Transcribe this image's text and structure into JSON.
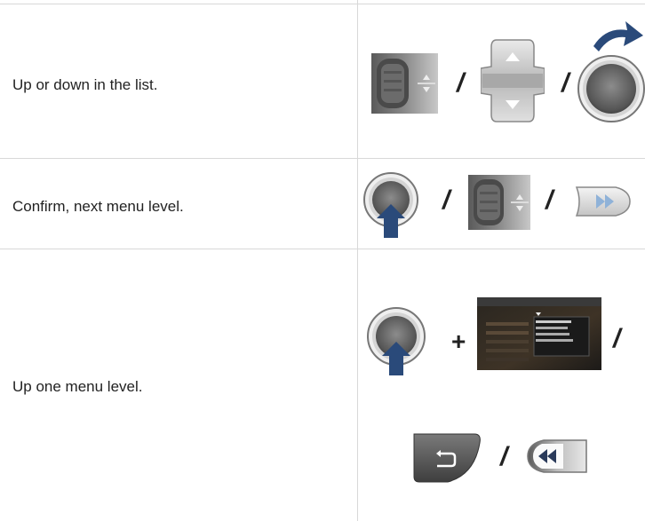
{
  "rows": [
    {
      "description": "Up or down in the list.",
      "controls": [
        "thumbwheel-icon",
        "up-down-rocker-icon",
        "rotary-knob-turn-icon"
      ],
      "separators": [
        "/",
        "/"
      ]
    },
    {
      "description": "Confirm, next menu level.",
      "controls": [
        "rotary-knob-press-icon",
        "thumbwheel-icon",
        "fast-forward-button-icon"
      ],
      "separators": [
        "/",
        "/"
      ]
    },
    {
      "description": "Up one menu level.",
      "controls": [
        "rotary-knob-press-icon",
        "screen-menu-icon",
        "back-button-icon",
        "rewind-button-icon"
      ],
      "separators": [
        "+",
        "/",
        "/"
      ]
    }
  ]
}
